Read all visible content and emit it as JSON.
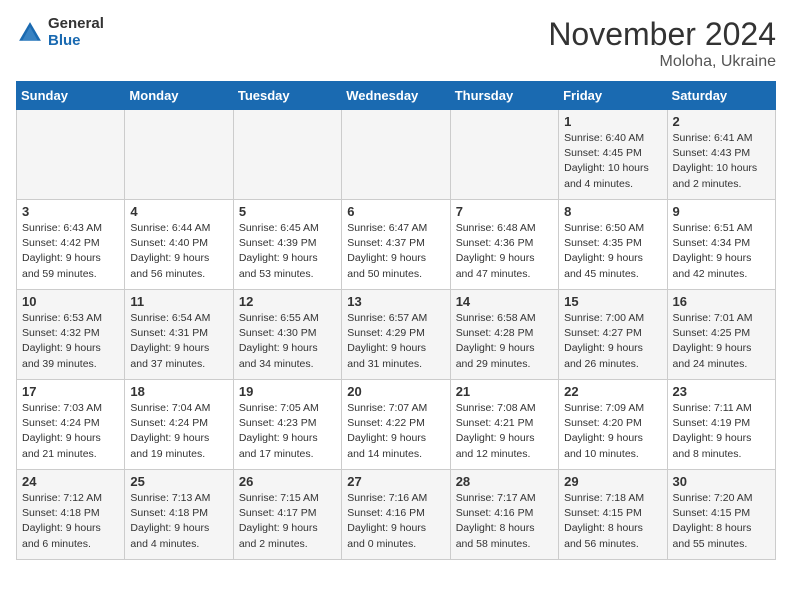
{
  "logo": {
    "general": "General",
    "blue": "Blue"
  },
  "title": "November 2024",
  "location": "Moloha, Ukraine",
  "days_of_week": [
    "Sunday",
    "Monday",
    "Tuesday",
    "Wednesday",
    "Thursday",
    "Friday",
    "Saturday"
  ],
  "weeks": [
    [
      {
        "day": "",
        "info": ""
      },
      {
        "day": "",
        "info": ""
      },
      {
        "day": "",
        "info": ""
      },
      {
        "day": "",
        "info": ""
      },
      {
        "day": "",
        "info": ""
      },
      {
        "day": "1",
        "info": "Sunrise: 6:40 AM\nSunset: 4:45 PM\nDaylight: 10 hours and 4 minutes."
      },
      {
        "day": "2",
        "info": "Sunrise: 6:41 AM\nSunset: 4:43 PM\nDaylight: 10 hours and 2 minutes."
      }
    ],
    [
      {
        "day": "3",
        "info": "Sunrise: 6:43 AM\nSunset: 4:42 PM\nDaylight: 9 hours and 59 minutes."
      },
      {
        "day": "4",
        "info": "Sunrise: 6:44 AM\nSunset: 4:40 PM\nDaylight: 9 hours and 56 minutes."
      },
      {
        "day": "5",
        "info": "Sunrise: 6:45 AM\nSunset: 4:39 PM\nDaylight: 9 hours and 53 minutes."
      },
      {
        "day": "6",
        "info": "Sunrise: 6:47 AM\nSunset: 4:37 PM\nDaylight: 9 hours and 50 minutes."
      },
      {
        "day": "7",
        "info": "Sunrise: 6:48 AM\nSunset: 4:36 PM\nDaylight: 9 hours and 47 minutes."
      },
      {
        "day": "8",
        "info": "Sunrise: 6:50 AM\nSunset: 4:35 PM\nDaylight: 9 hours and 45 minutes."
      },
      {
        "day": "9",
        "info": "Sunrise: 6:51 AM\nSunset: 4:34 PM\nDaylight: 9 hours and 42 minutes."
      }
    ],
    [
      {
        "day": "10",
        "info": "Sunrise: 6:53 AM\nSunset: 4:32 PM\nDaylight: 9 hours and 39 minutes."
      },
      {
        "day": "11",
        "info": "Sunrise: 6:54 AM\nSunset: 4:31 PM\nDaylight: 9 hours and 37 minutes."
      },
      {
        "day": "12",
        "info": "Sunrise: 6:55 AM\nSunset: 4:30 PM\nDaylight: 9 hours and 34 minutes."
      },
      {
        "day": "13",
        "info": "Sunrise: 6:57 AM\nSunset: 4:29 PM\nDaylight: 9 hours and 31 minutes."
      },
      {
        "day": "14",
        "info": "Sunrise: 6:58 AM\nSunset: 4:28 PM\nDaylight: 9 hours and 29 minutes."
      },
      {
        "day": "15",
        "info": "Sunrise: 7:00 AM\nSunset: 4:27 PM\nDaylight: 9 hours and 26 minutes."
      },
      {
        "day": "16",
        "info": "Sunrise: 7:01 AM\nSunset: 4:25 PM\nDaylight: 9 hours and 24 minutes."
      }
    ],
    [
      {
        "day": "17",
        "info": "Sunrise: 7:03 AM\nSunset: 4:24 PM\nDaylight: 9 hours and 21 minutes."
      },
      {
        "day": "18",
        "info": "Sunrise: 7:04 AM\nSunset: 4:24 PM\nDaylight: 9 hours and 19 minutes."
      },
      {
        "day": "19",
        "info": "Sunrise: 7:05 AM\nSunset: 4:23 PM\nDaylight: 9 hours and 17 minutes."
      },
      {
        "day": "20",
        "info": "Sunrise: 7:07 AM\nSunset: 4:22 PM\nDaylight: 9 hours and 14 minutes."
      },
      {
        "day": "21",
        "info": "Sunrise: 7:08 AM\nSunset: 4:21 PM\nDaylight: 9 hours and 12 minutes."
      },
      {
        "day": "22",
        "info": "Sunrise: 7:09 AM\nSunset: 4:20 PM\nDaylight: 9 hours and 10 minutes."
      },
      {
        "day": "23",
        "info": "Sunrise: 7:11 AM\nSunset: 4:19 PM\nDaylight: 9 hours and 8 minutes."
      }
    ],
    [
      {
        "day": "24",
        "info": "Sunrise: 7:12 AM\nSunset: 4:18 PM\nDaylight: 9 hours and 6 minutes."
      },
      {
        "day": "25",
        "info": "Sunrise: 7:13 AM\nSunset: 4:18 PM\nDaylight: 9 hours and 4 minutes."
      },
      {
        "day": "26",
        "info": "Sunrise: 7:15 AM\nSunset: 4:17 PM\nDaylight: 9 hours and 2 minutes."
      },
      {
        "day": "27",
        "info": "Sunrise: 7:16 AM\nSunset: 4:16 PM\nDaylight: 9 hours and 0 minutes."
      },
      {
        "day": "28",
        "info": "Sunrise: 7:17 AM\nSunset: 4:16 PM\nDaylight: 8 hours and 58 minutes."
      },
      {
        "day": "29",
        "info": "Sunrise: 7:18 AM\nSunset: 4:15 PM\nDaylight: 8 hours and 56 minutes."
      },
      {
        "day": "30",
        "info": "Sunrise: 7:20 AM\nSunset: 4:15 PM\nDaylight: 8 hours and 55 minutes."
      }
    ]
  ]
}
